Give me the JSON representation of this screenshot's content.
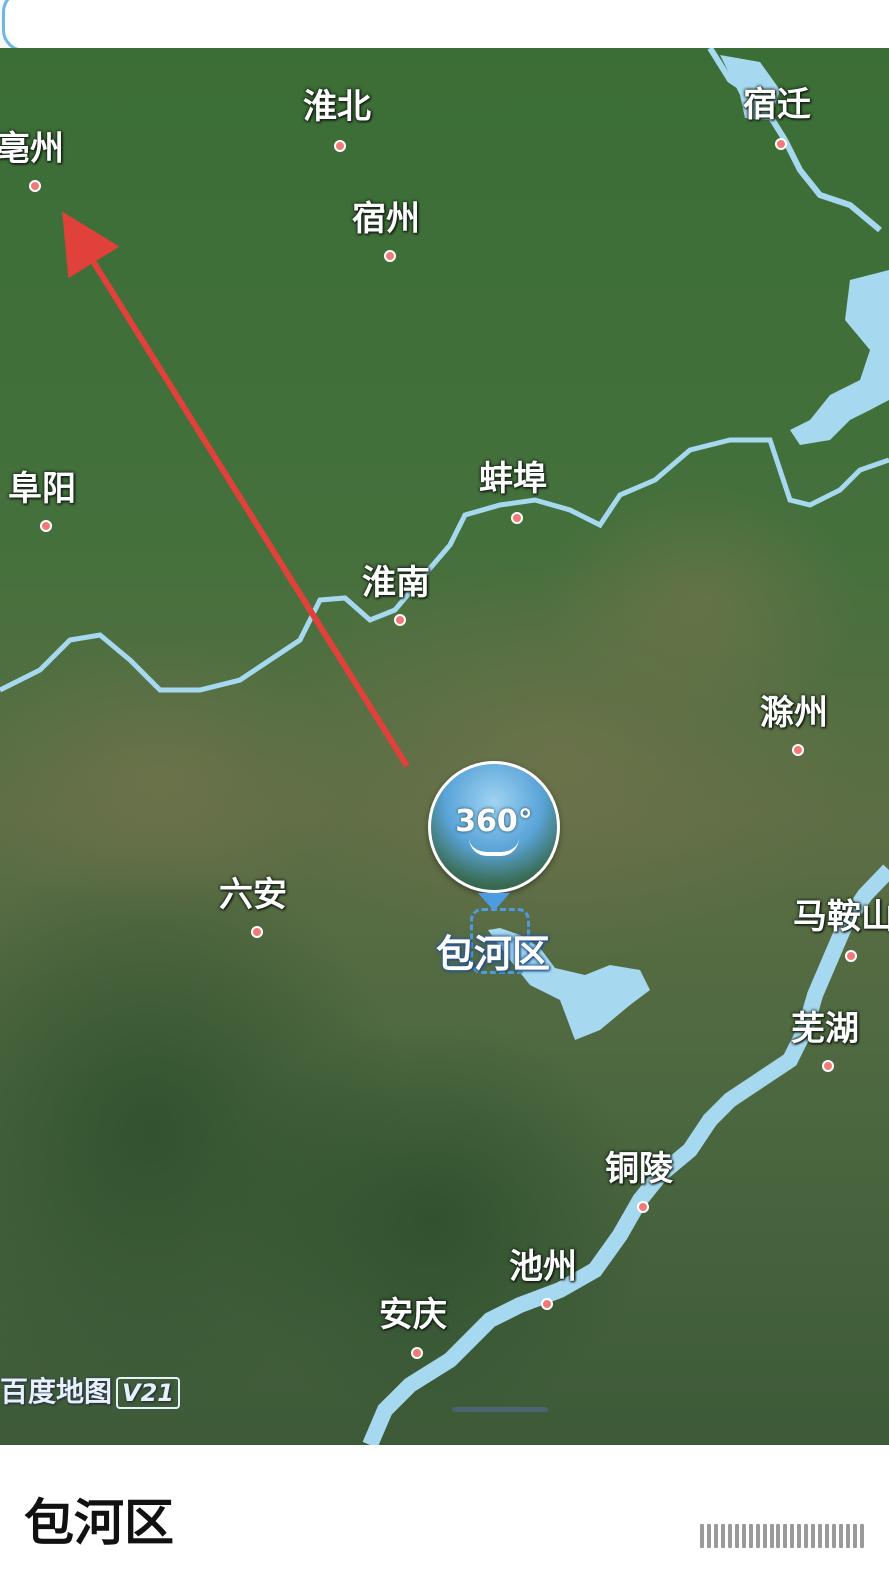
{
  "map": {
    "cities": [
      {
        "id": "bozhou",
        "name": "亳州"
      },
      {
        "id": "huaibei",
        "name": "淮北"
      },
      {
        "id": "suqian",
        "name": "宿迁"
      },
      {
        "id": "suzhou",
        "name": "宿州"
      },
      {
        "id": "fuyang",
        "name": "阜阳"
      },
      {
        "id": "bengbu",
        "name": "蚌埠"
      },
      {
        "id": "huainan",
        "name": "淮南"
      },
      {
        "id": "chuzhou",
        "name": "滁州"
      },
      {
        "id": "luan",
        "name": "六安"
      },
      {
        "id": "maanshan",
        "name": "马鞍山"
      },
      {
        "id": "wuhu",
        "name": "芜湖"
      },
      {
        "id": "tongling",
        "name": "铜陵"
      },
      {
        "id": "chizhou",
        "name": "池州"
      },
      {
        "id": "anqing",
        "name": "安庆"
      }
    ],
    "panorama_label": "360°",
    "district_label": "包河区",
    "watermark": "百度地图",
    "watermark_version": "V21",
    "colors": {
      "land_green": "#3f6b3a",
      "water": "#a6d8f0",
      "arrow": "#e0413a",
      "city_dot": "#f07a7a",
      "marker_blue": "#4d9be0"
    }
  },
  "panel": {
    "title": "包河区"
  }
}
